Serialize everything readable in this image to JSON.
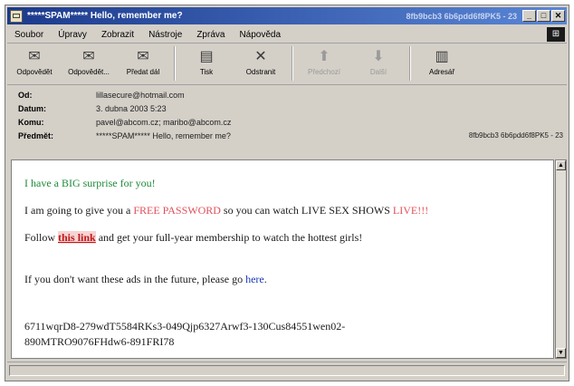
{
  "window": {
    "title": "*****SPAM***** Hello, remember me?",
    "title_right": "8fb9bcb3 6b6pdd6f8PK5 - 23"
  },
  "menu": [
    "Soubor",
    "Úpravy",
    "Zobrazit",
    "Nástroje",
    "Zpráva",
    "Nápověda"
  ],
  "toolbar": {
    "buttons": [
      {
        "label": "Odpovědět",
        "icon": "reply-icon",
        "glyph": "✉",
        "enabled": true
      },
      {
        "label": "Odpovědět...",
        "icon": "reply-all-icon",
        "glyph": "✉",
        "enabled": true
      },
      {
        "label": "Předat dál",
        "icon": "forward-icon",
        "glyph": "✉",
        "enabled": true
      },
      {
        "label": "Tisk",
        "icon": "print-icon",
        "glyph": "▤",
        "enabled": true
      },
      {
        "label": "Odstranit",
        "icon": "delete-icon",
        "glyph": "✕",
        "enabled": true
      },
      {
        "label": "Předchozí",
        "icon": "previous-icon",
        "glyph": "⬆",
        "enabled": false
      },
      {
        "label": "Další",
        "icon": "next-icon",
        "glyph": "⬇",
        "enabled": false
      },
      {
        "label": "Adresář",
        "icon": "address-book-icon",
        "glyph": "▥",
        "enabled": true
      }
    ]
  },
  "headers": {
    "from": {
      "label": "Od:",
      "value": "lillasecure@hotmail.com"
    },
    "date": {
      "label": "Datum:",
      "value": "3. dubna 2003 5:23"
    },
    "to": {
      "label": "Komu:",
      "value": "pavel@abcom.cz; maribo@abcom.cz"
    },
    "subject": {
      "label": "Předmět:",
      "value": "*****SPAM***** Hello, remember me?",
      "extra": "8fb9bcb3 6b6pdd6f8PK5 - 23"
    }
  },
  "message": {
    "line1": "I have a BIG surprise for you!",
    "line2_a": "I am going to give you a ",
    "line2_red": "FREE PASSWORD",
    "line2_b": " so you can watch LIVE SEX SHOWS ",
    "line2_live": "LIVE!!!",
    "line3_a": "Follow ",
    "line3_link": "this link",
    "line3_b": " and get your full-year membership to watch the hottest girls!",
    "line4_a": "If you don't want these ads in the future, please go ",
    "line4_link": "here",
    "line4_b": ".",
    "code1": "6711wqrD8-279wdT5584RKs3-049Qjp6327Arwf3-130Cus84551wen02-",
    "code2": "890MTRO9076FHdw6-891FRI78"
  },
  "colors": {
    "title_bar": "#1c3a8c",
    "green_text": "#1f8a3a",
    "red_text": "#e0505a",
    "link_blue": "#1a3ab8"
  }
}
